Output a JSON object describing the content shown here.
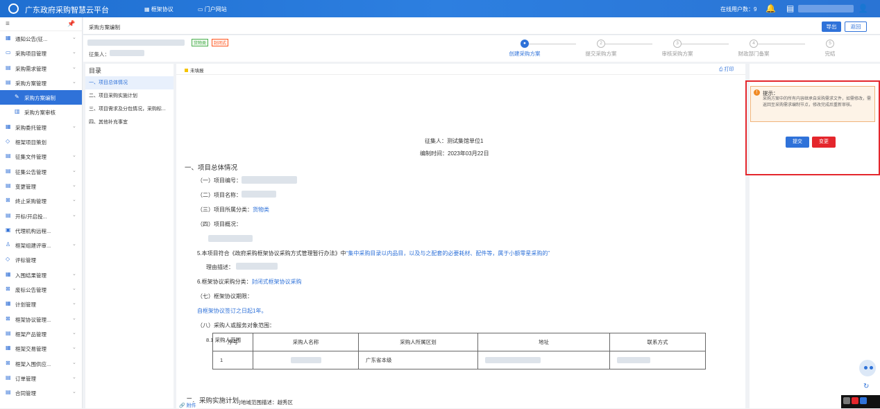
{
  "topbar": {
    "title": "广东政府采购智慧云平台",
    "nav_frame": "框架协议",
    "nav_portal": "门户网站",
    "online": "在线用户数：9"
  },
  "sidebar": {
    "items": [
      {
        "label": "通知公告(征...",
        "icon": "grid-icon",
        "chevron": true
      },
      {
        "label": "采购项目管理",
        "icon": "folder-icon",
        "chevron": true
      },
      {
        "label": "采购需求管理",
        "icon": "doc-icon",
        "chevron": true
      },
      {
        "label": "采购方案管理",
        "icon": "doc-icon",
        "chevron": true
      },
      {
        "label": "采购方案编制",
        "icon": "edit-icon",
        "chevron": false,
        "sub": true,
        "active": true
      },
      {
        "label": "采购方案审核",
        "icon": "audit-icon",
        "chevron": false,
        "sub": true
      },
      {
        "label": "采购委托管理",
        "icon": "grid-icon",
        "chevron": true
      },
      {
        "label": "框架项目策划",
        "icon": "diamond-icon",
        "chevron": false
      },
      {
        "label": "征集文件管理",
        "icon": "doc-icon",
        "chevron": true
      },
      {
        "label": "征集公告管理",
        "icon": "doc-icon",
        "chevron": true
      },
      {
        "label": "变更管理",
        "icon": "doc-icon",
        "chevron": true
      },
      {
        "label": "终止采购管理",
        "icon": "stop-icon",
        "chevron": true
      },
      {
        "label": "开标/开启投...",
        "icon": "doc-icon",
        "chevron": true
      },
      {
        "label": "代理机构远程...",
        "icon": "monitor-icon",
        "chevron": false
      },
      {
        "label": "框架组建评审...",
        "icon": "user-icon",
        "chevron": true
      },
      {
        "label": "评标管理",
        "icon": "diamond-icon",
        "chevron": false
      },
      {
        "label": "入围结果管理",
        "icon": "grid-icon",
        "chevron": true
      },
      {
        "label": "废标公告管理",
        "icon": "stop-icon",
        "chevron": true
      },
      {
        "label": "计划管理",
        "icon": "grid-icon",
        "chevron": true
      },
      {
        "label": "框架协议管理...",
        "icon": "stop-icon",
        "chevron": true
      },
      {
        "label": "框架产品管理",
        "icon": "doc-icon",
        "chevron": true
      },
      {
        "label": "框架交易管理",
        "icon": "grid-icon",
        "chevron": true
      },
      {
        "label": "框架入围供应...",
        "icon": "stop-icon",
        "chevron": true
      },
      {
        "label": "订单管理",
        "icon": "doc-icon",
        "chevron": true
      },
      {
        "label": "合同管理",
        "icon": "doc-icon",
        "chevron": true
      }
    ]
  },
  "page": {
    "title": "采购方案编制",
    "export": "导出",
    "back": "返回",
    "tag1": "货物类",
    "tag2": "封闭式",
    "collector_label": "征集人："
  },
  "steps": [
    "创建采购方案",
    "提交采购方案",
    "审核采购方案",
    "财政部门备案",
    "完结"
  ],
  "toc": {
    "title": "目录",
    "items": [
      "一、项目总体情况",
      "二、项目采购实施计划",
      "三、项目需求及分包情况，采购标...",
      "四、其他补充事宜"
    ]
  },
  "doc": {
    "status": "未填报",
    "print": "打印",
    "collector": "征集人：测试集馆单位1",
    "date": "编制时间：2023年03月22日",
    "sec1": "一、项目总体情况",
    "l1": "（一）项目编号：",
    "l2": "（二）项目名称：",
    "l3": "（三）项目所属分类：",
    "l3v": "货物类",
    "l4": "（四）项目概况：",
    "l5a": "5.本项目符合《政府采购框架协议采购方式管理暂行办法》中",
    "l5b": "“集中采购目录以内品目，以及与之配套的必要耗材、配件等，属于小额零星采购的”",
    "l5c": "理由描述：",
    "l6": "6.框架协议采购分类：",
    "l6v": "封闭式框架协议采购",
    "l7": "（七）框架协议期限：",
    "l7v": "自框架协议签订之日起1年。",
    "l8": "（八）采购人或服务对象范围：",
    "l81": "8.1 采购人范围",
    "table": {
      "headers": [
        "序号",
        "采购人名称",
        "采购人所属区划",
        "地址",
        "联系方式"
      ],
      "rows": [
        [
          "1",
          "",
          "广东省本级",
          "",
          ""
        ]
      ]
    },
    "l82": "8.2 履行合同的地域范围描述：越秀区",
    "sec2": "二、采购实施计划",
    "attach": "附件"
  },
  "hint": {
    "title": "提示：",
    "body": "采购方案中的所有内容继承自采购需求文件，如需修改，需返回至采购需求编制节点，修改完成后重新审核。",
    "submit": "提交",
    "change": "变更"
  }
}
